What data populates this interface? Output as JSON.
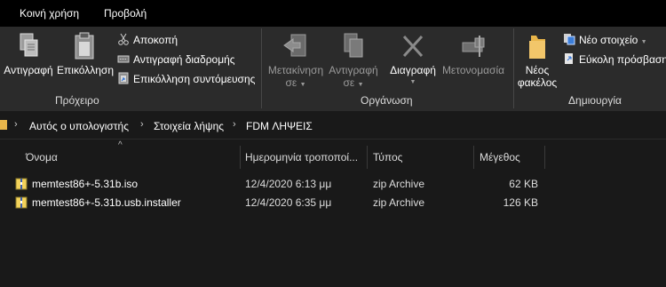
{
  "tabs": {
    "home": "Κοινή χρήση",
    "view": "Προβολή"
  },
  "ribbon": {
    "clipboard": {
      "label": "Πρόχειρο",
      "copy": "Αντιγραφή",
      "paste": "Επικόλληση",
      "cut": "Αποκοπή",
      "copy_path": "Αντιγραφή διαδρομής",
      "paste_shortcut": "Επικόλληση συντόμευσης"
    },
    "organize": {
      "label": "Οργάνωση",
      "move_to_line1": "Μετακίνηση",
      "move_to_line2": "σε",
      "copy_to_line1": "Αντιγραφή",
      "copy_to_line2": "σε",
      "delete": "Διαγραφή",
      "rename": "Μετονομασία"
    },
    "new": {
      "label": "Δημιουργία",
      "new_folder_line1": "Νέος",
      "new_folder_line2": "φακέλος",
      "new_item": "Νέο στοιχείο",
      "easy_access": "Εύκολη πρόσβαση"
    }
  },
  "address": {
    "crumbs": [
      "Αυτός ο υπολογιστής",
      "Στοιχεία λήψης",
      "FDM ΛΗΨΕΙΣ"
    ]
  },
  "columns": {
    "name": "Όνομα",
    "date": "Ημερομηνία τροποποί...",
    "type": "Τύπος",
    "size": "Μέγεθος"
  },
  "files": [
    {
      "name": "memtest86+-5.31b.iso",
      "date": "12/4/2020 6:13 μμ",
      "type": "zip Archive",
      "size": "62 KB"
    },
    {
      "name": "memtest86+-5.31b.usb.installer",
      "date": "12/4/2020 6:35 μμ",
      "type": "zip Archive",
      "size": "126 KB"
    }
  ],
  "colors": {
    "background": "#191919",
    "ribbon": "#2b2b2b",
    "tabbar": "#000000",
    "folder": "#e8b54a"
  }
}
